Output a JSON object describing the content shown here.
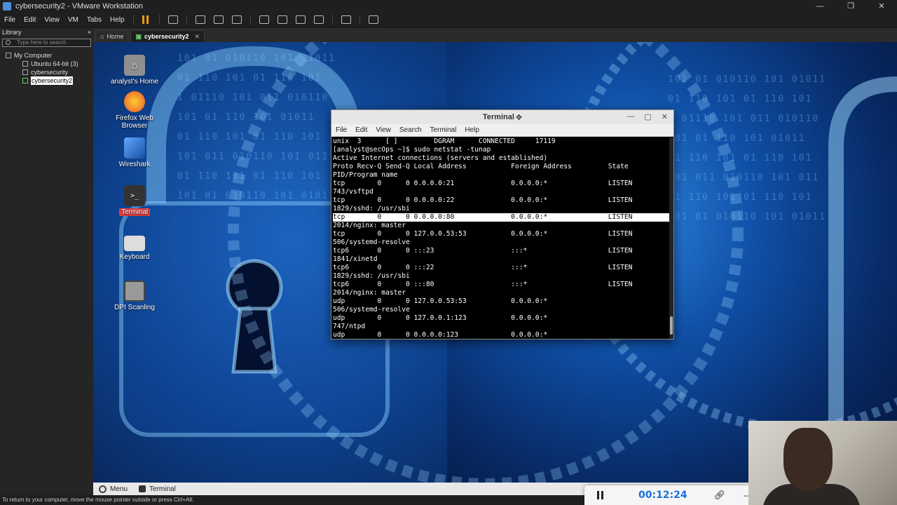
{
  "vm": {
    "title": "cybersecurity2 - VMware Workstation",
    "window_controls": [
      "—",
      "❐",
      "✕"
    ],
    "menu": [
      "File",
      "Edit",
      "View",
      "VM",
      "Tabs",
      "Help"
    ],
    "status_hint": "To return to your computer, move the mouse pointer outside or press Ctrl+Alt."
  },
  "library": {
    "title": "Library",
    "close": "×",
    "search_placeholder": "Type here to search",
    "tree": [
      {
        "label": "My Computer"
      },
      {
        "label": "Ubuntu 64-bit (3)"
      },
      {
        "label": "cybersecurity"
      },
      {
        "label": "cybersecurity2"
      }
    ]
  },
  "tabs": [
    {
      "label": "Home"
    },
    {
      "label": "cybersecurity2"
    }
  ],
  "desktop": {
    "icons": [
      {
        "label": "analyst's Home",
        "icon": "home-folder-icon"
      },
      {
        "label": "Firefox Web Browser",
        "icon": "firefox-icon"
      },
      {
        "label": "Wireshark",
        "icon": "wireshark-icon"
      },
      {
        "label": "Terminal",
        "icon": "terminal-icon"
      },
      {
        "label": "Keyboard",
        "icon": "keyboard-icon"
      },
      {
        "label": "DPI Scanling",
        "icon": "screenshot-icon"
      }
    ]
  },
  "terminal": {
    "title": "Terminal",
    "menu": [
      "File",
      "Edit",
      "View",
      "Search",
      "Terminal",
      "Help"
    ],
    "lines": [
      "unix  3      [ ]         DGRAM      CONNECTED     17119",
      "[analyst@secOps ~]$ sudo netstat -tunap",
      "Active Internet connections (servers and established)",
      "Proto Recv-Q Send-Q Local Address           Foreign Address         State",
      "PID/Program name",
      "tcp        0      0 0.0.0.0:21              0.0.0.0:*               LISTEN",
      "743/vsftpd",
      "tcp        0      0 0.0.0.0:22              0.0.0.0:*               LISTEN",
      "1829/sshd: /usr/sbi",
      "tcp        0      0 0.0.0.0:80              0.0.0.0:*               LISTEN",
      "2014/nginx: master",
      "tcp        0      0 127.0.0.53:53           0.0.0.0:*               LISTEN",
      "506/systemd-resolve",
      "tcp6       0      0 :::23                   :::*                    LISTEN",
      "1841/xinetd",
      "tcp6       0      0 :::22                   :::*                    LISTEN",
      "1829/sshd: /usr/sbi",
      "tcp6       0      0 :::80                   :::*                    LISTEN",
      "2014/nginx: master",
      "udp        0      0 127.0.0.53:53           0.0.0.0:*",
      "506/systemd-resolve",
      "udp        0      0 127.0.0.1:123           0.0.0.0:*",
      "747/ntpd",
      "udp        0      0 0.0.0.0:123             0.0.0.0:*"
    ],
    "highlighted_line_index": 9
  },
  "taskbar": {
    "menu_label": "Menu",
    "terminal_label": "Terminal"
  },
  "recorder": {
    "timer": "00:12:24"
  },
  "background_glyphs": "101 01 010110 101 01011\n01 110 101 01 110 101\n1 01110 101 011 010110\n101 01 110 101 01011\n01 110 101 01 110 101\n101 011 010110 101 011\n01 110 101 01 110 101\n101 01 010110 101 01011"
}
